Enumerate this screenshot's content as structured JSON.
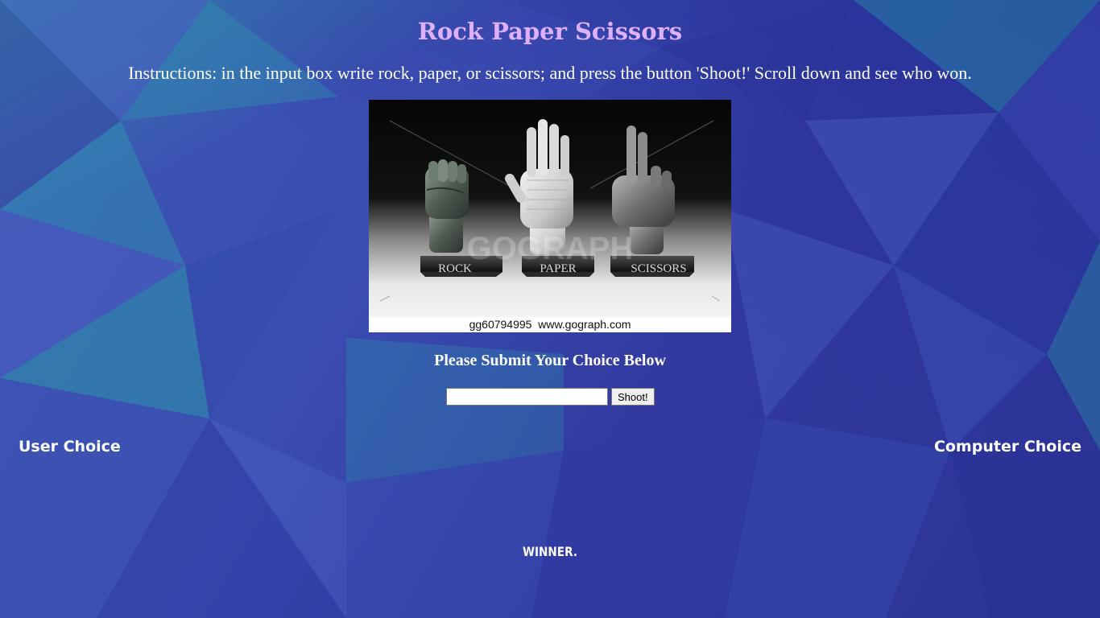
{
  "page": {
    "title": "Rock Paper Scissors",
    "instructions": "Instructions: in the input box write rock, paper, or scissors; and press the button 'Shoot!' Scroll down and see who won."
  },
  "hero": {
    "labels": [
      "ROCK",
      "PAPER",
      "SCISSORS"
    ],
    "watermark": "GOGRAPH",
    "caption": "gg60794995  www.gograph.com"
  },
  "form": {
    "prompt": "Please Submit Your Choice Below",
    "input_value": "",
    "input_placeholder": "",
    "button_label": "Shoot!"
  },
  "results": {
    "user_label": "User Choice",
    "computer_label": "Computer Choice",
    "winner_text": "WINNER."
  },
  "colors": {
    "title": "#dfb0ff",
    "text": "#ffffff",
    "background": "#3a46a8",
    "accent_teal": "#2ea0aa"
  }
}
